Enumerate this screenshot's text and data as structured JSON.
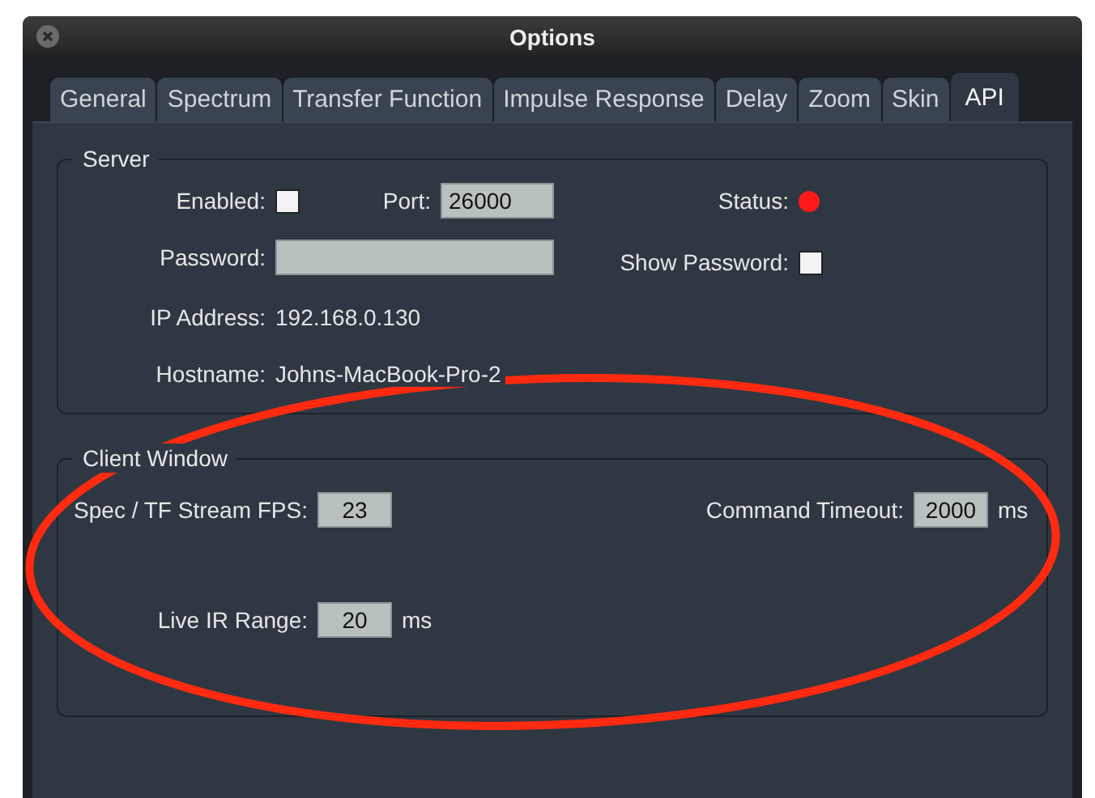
{
  "window": {
    "title": "Options"
  },
  "tabs": [
    {
      "label": "General",
      "selected": false
    },
    {
      "label": "Spectrum",
      "selected": false
    },
    {
      "label": "Transfer Function",
      "selected": false
    },
    {
      "label": "Impulse Response",
      "selected": false
    },
    {
      "label": "Delay",
      "selected": false
    },
    {
      "label": "Zoom",
      "selected": false
    },
    {
      "label": "Skin",
      "selected": false
    },
    {
      "label": "API",
      "selected": true
    }
  ],
  "server": {
    "title": "Server",
    "enabled": {
      "label": "Enabled:",
      "checked": false
    },
    "port": {
      "label": "Port:",
      "value": "26000"
    },
    "status": {
      "label": "Status:",
      "running": false
    },
    "password": {
      "label": "Password:"
    },
    "show_password": {
      "label": "Show Password:",
      "checked": false
    },
    "ip_address": {
      "label": "IP Address:",
      "value": "192.168.0.130"
    },
    "hostname": {
      "label": "Hostname:",
      "value": "Johns-MacBook-Pro-2"
    }
  },
  "client_window": {
    "title": "Client Window",
    "fps": {
      "label": "Spec / TF Stream FPS:",
      "value": "23"
    },
    "command_timeout": {
      "label": "Command Timeout:",
      "value": "2000",
      "unit": "ms"
    },
    "live_ir_range": {
      "label": "Live IR Range:",
      "value": "20",
      "unit": "ms"
    }
  }
}
